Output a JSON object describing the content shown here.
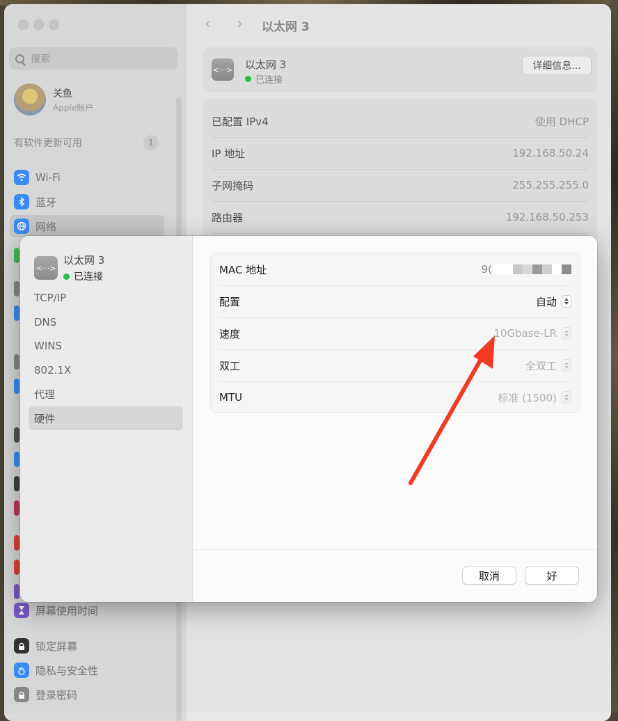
{
  "sidebar": {
    "search_placeholder": "搜索",
    "account_name": "关鱼",
    "account_sub": "Apple账户",
    "update_label": "有软件更新可用",
    "update_count": "1",
    "items": [
      {
        "label": "Wi-Fi",
        "icon": "wifi-icon",
        "color": "#3d8ef7"
      },
      {
        "label": "蓝牙",
        "icon": "bluetooth-icon",
        "color": "#3d8ef7"
      },
      {
        "label": "网络",
        "icon": "globe-icon",
        "color": "#3d8ef7"
      }
    ],
    "items_bottom": [
      {
        "label": "屏幕使用时间",
        "icon": "hourglass-icon",
        "color": "#7a5cc8"
      },
      {
        "label": "锁定屏幕",
        "icon": "lock-icon",
        "color": "#333333"
      },
      {
        "label": "隐私与安全性",
        "icon": "hand-icon",
        "color": "#3d8ef7"
      },
      {
        "label": "登录密码",
        "icon": "lock-icon",
        "color": "#8a8a8a"
      }
    ]
  },
  "main": {
    "title": "以太网 3",
    "header": {
      "name": "以太网 3",
      "status": "已连接",
      "details_button": "详细信息..."
    },
    "rows": [
      {
        "label": "已配置 IPv4",
        "value": "使用 DHCP"
      },
      {
        "label": "IP 地址",
        "value": "192.168.50.24"
      },
      {
        "label": "子网掩码",
        "value": "255.255.255.0"
      },
      {
        "label": "路由器",
        "value": "192.168.50.253"
      }
    ]
  },
  "dialog": {
    "name": "以太网 3",
    "status": "已连接",
    "nav": [
      "TCP/IP",
      "DNS",
      "WINS",
      "802.1X",
      "代理",
      "硬件"
    ],
    "selected_nav": "硬件",
    "hardware": {
      "mac_label": "MAC 地址",
      "mac_value_visible": "9(",
      "config_label": "配置",
      "config_value": "自动",
      "speed_label": "速度",
      "speed_value": "10Gbase-LR",
      "duplex_label": "双工",
      "duplex_value": "全双工",
      "mtu_label": "MTU",
      "mtu_value": "标准 (1500)"
    },
    "cancel_button": "取消",
    "ok_button": "好"
  },
  "colors": {
    "status_green": "#29c244",
    "annotation_red": "#f23a22"
  }
}
